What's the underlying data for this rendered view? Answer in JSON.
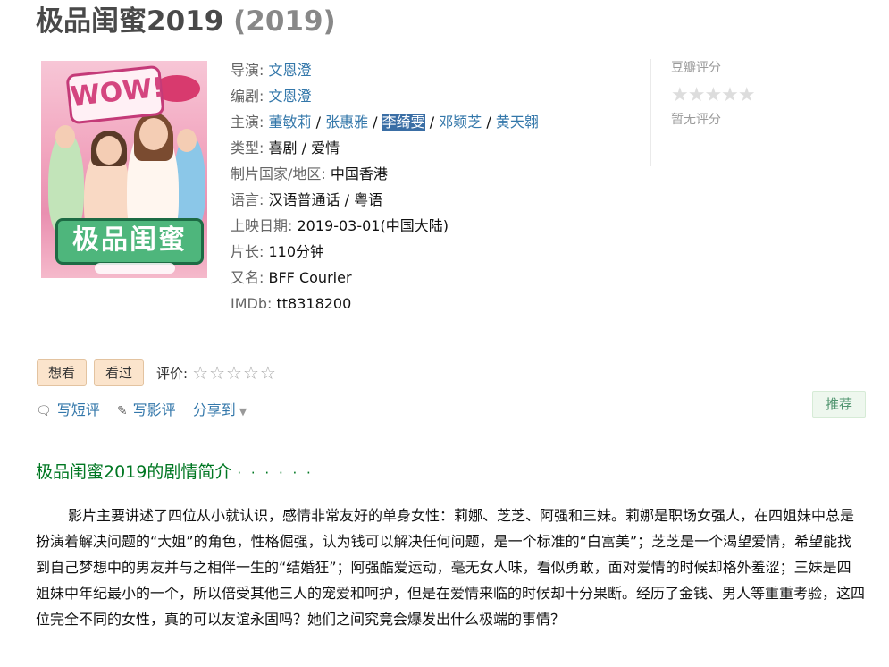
{
  "page": {
    "title": "极品闺蜜2019",
    "year": "(2019)"
  },
  "poster": {
    "wow_text": "WOW!",
    "logo_text": "极品闺蜜"
  },
  "info": {
    "director_label": "导演:",
    "director": "文恩澄",
    "writer_label": "编剧:",
    "writer": "文恩澄",
    "cast_label": "主演:",
    "cast": [
      "董敏莉",
      "张惠雅",
      "李绮雯",
      "邓颖芝",
      "黄天翱"
    ],
    "genre_label": "类型:",
    "genre": "喜剧 / 爱情",
    "country_label": "制片国家/地区:",
    "country": "中国香港",
    "language_label": "语言:",
    "language": "汉语普通话 / 粤语",
    "release_label": "上映日期:",
    "release": "2019-03-01(中国大陆)",
    "runtime_label": "片长:",
    "runtime": "110分钟",
    "aka_label": "又名:",
    "aka": "BFF Courier",
    "imdb_label": "IMDb:",
    "imdb": "tt8318200"
  },
  "rating": {
    "label": "豆瓣评分",
    "stars": "★★★★★",
    "no_rating": "暂无评分"
  },
  "actions": {
    "want_to_watch": "想看",
    "watched": "看过",
    "rate_label": "评价:",
    "rate_stars": "☆☆☆☆☆"
  },
  "links": {
    "short_review": "写短评",
    "review": "写影评",
    "share": "分享到"
  },
  "recommend": "推荐",
  "summary": {
    "title": "极品闺蜜2019的剧情简介",
    "dots": "· · · · · ·",
    "text": "影片主要讲述了四位从小就认识，感情非常友好的单身女性：莉娜、芝芝、阿强和三妹。莉娜是职场女强人，在四姐妹中总是扮演着解决问题的“大姐”的角色，性格倔强，认为钱可以解决任何问题，是一个标准的“白富美”；芝芝是一个渴望爱情，希望能找到自己梦想中的男友并与之相伴一生的“结婚狂”；阿强酷爱运动，毫无女人味，看似勇敢，面对爱情的时候却格外羞涩；三妹是四姐妹中年纪最小的一个，所以倍受其他三人的宠爱和呵护，但是在爱情来临的时候却十分果断。经历了金钱、男人等重重考验，这四位完全不同的女性，真的可以友谊永固吗？她们之间究竟会爆发出什么极端的事情？"
  }
}
